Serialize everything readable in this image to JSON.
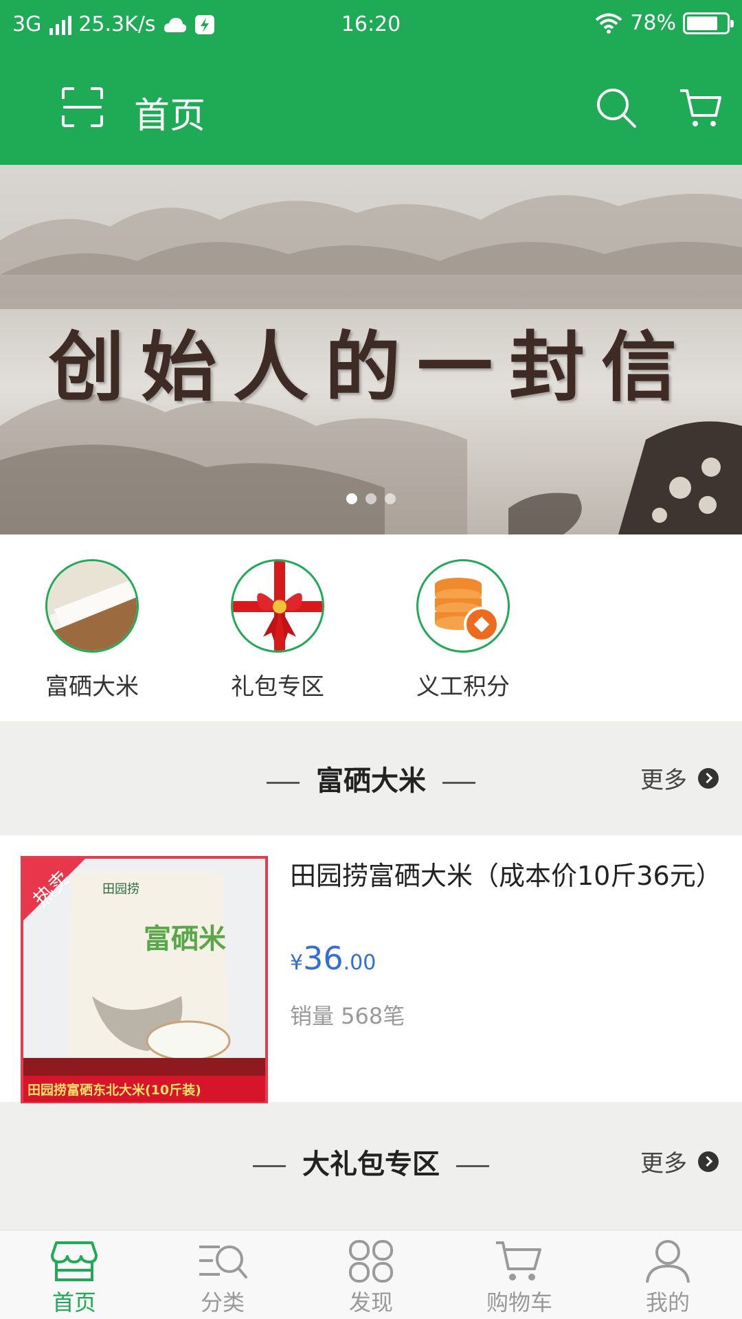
{
  "status_bar": {
    "network": "3G",
    "speed": "25.3K/s",
    "time": "16:20",
    "battery": "78%",
    "battery_level": 0.78
  },
  "header": {
    "title": "首页",
    "color": "#1faa55"
  },
  "banner": {
    "text": "创始人的一封信",
    "page_count": 3,
    "active_page": 1
  },
  "categories": [
    {
      "label": "富硒大米",
      "icon": "rice-icon"
    },
    {
      "label": "礼包专区",
      "icon": "gift-bow-icon"
    },
    {
      "label": "义工积分",
      "icon": "coins-icon"
    }
  ],
  "sections": [
    {
      "title": "富硒大米",
      "more": "更多"
    },
    {
      "title": "大礼包专区",
      "more": "更多"
    }
  ],
  "product": {
    "name": "田园捞富硒大米（成本价10斤36元）",
    "price_currency": "¥",
    "price_int": "36",
    "price_dec": ".00",
    "sales": "销量 568笔",
    "image_badge": "热卖",
    "image_brand": "田园捞",
    "image_bag_text": "富硒米",
    "image_caption": "田园捞富硒东北大米(10斤装)"
  },
  "tabbar": [
    {
      "label": "首页",
      "icon": "store-icon",
      "active": true
    },
    {
      "label": "分类",
      "icon": "category-search-icon",
      "active": false
    },
    {
      "label": "发现",
      "icon": "discover-grid-icon",
      "active": false
    },
    {
      "label": "购物车",
      "icon": "cart-icon",
      "active": false
    },
    {
      "label": "我的",
      "icon": "user-icon",
      "active": false
    }
  ]
}
